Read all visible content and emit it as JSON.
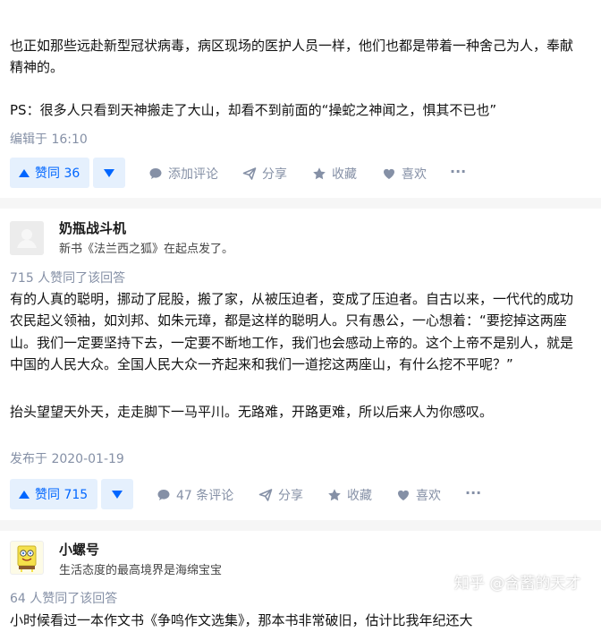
{
  "answer1": {
    "lines": [
      "也正如那些远赴新型冠状病毒，病区现场的医护人员一样，他们也都是带着一种舍己为人，奉献",
      "精神的。",
      "PS：很多人只看到天神搬走了大山，却看不到前面的“操蛇之神闻之，惧其不已也”"
    ],
    "edited": "编辑于 16:10",
    "actions": {
      "vote_up": "赞同 36",
      "comment": "添加评论",
      "share": "分享",
      "favorite": "收藏",
      "like": "喜欢",
      "more": "···"
    }
  },
  "answer2": {
    "author": "奶瓶战斗机",
    "bio": "新书《法兰西之狐》在起点发了。",
    "upvoters": "715 人赞同了该回答",
    "lines": [
      "有的人真的聪明，挪动了屁股，搬了家，从被压迫者，变成了压迫者。自古以来，一代代的成功",
      "农民起义领袖，如刘邦、如朱元璋，都是这样的聪明人。只有愚公，一心想着：“要挖掉这两座",
      "山。我们一定要坚持下去，一定要不断地工作，我们也会感动上帝的。这个上帝不是别人，就是",
      "中国的人民大众。全国人民大众一齐起来和我们一道挖这两座山，有什么挖不平呢？”",
      "抬头望望天外天，走走脚下一马平川。无路难，开路更难，所以后来人为你感叹。"
    ],
    "published": "发布于 2020-01-19",
    "actions": {
      "vote_up": "赞同 715",
      "comment": "47 条评论",
      "share": "分享",
      "favorite": "收藏",
      "like": "喜欢",
      "more": "···"
    }
  },
  "answer3": {
    "author": "小螺号",
    "bio": "生活态度的最高境界是海绵宝宝",
    "upvoters": "64 人赞同了该回答",
    "lines": [
      "小时候看过一本作文书《争鸣作文选集》，那本书非常破旧，估计比我年纪还大"
    ]
  },
  "watermark": "知乎 @含蓄的天才",
  "colors": {
    "accent": "#0066ff",
    "accent_bg": "#e5f0fd",
    "meta": "#8590a6",
    "separator": "#f6f6f6"
  }
}
